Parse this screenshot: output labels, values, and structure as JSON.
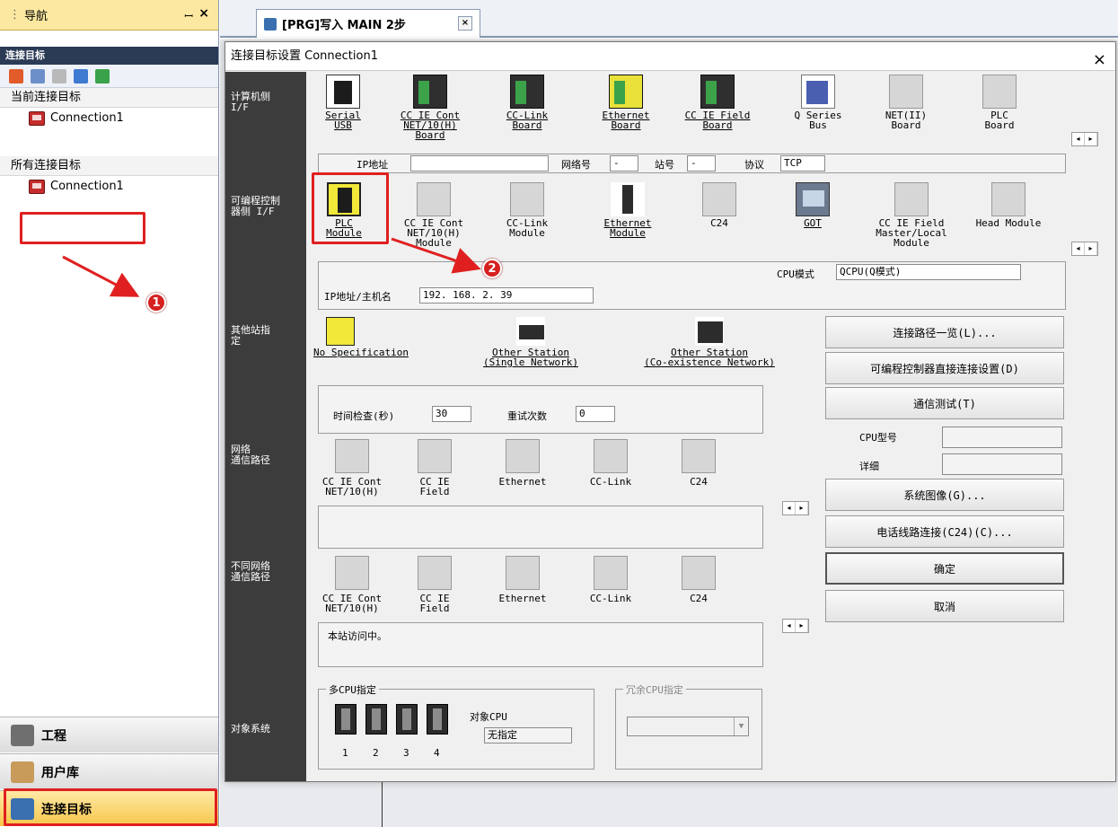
{
  "nav": {
    "title": "导航",
    "pin_glyph": "ꟷ",
    "close_glyph": "×",
    "subhead": "连接目标",
    "current_section": "当前连接目标",
    "current_item": "Connection1",
    "all_section": "所有连接目标",
    "all_item": "Connection1",
    "bottom": {
      "project": "工程",
      "library": "用户库",
      "connection": "连接目标"
    }
  },
  "annotations": {
    "badge1": "1",
    "badge2": "2"
  },
  "tab": {
    "label": "[PRG]写入 MAIN 2步",
    "close_glyph": "×"
  },
  "dialog": {
    "title": "连接目标设置 Connection1",
    "close_glyph": "×",
    "side": {
      "pc_if": "计算机侧\nI/F",
      "plc_if": "可编程控制\n器侧 I/F",
      "other_station": "其他站指\n定",
      "network_route": "网络\n通信路径",
      "diff_network_route": "不同网络\n通信路径",
      "target_system": "对象系统"
    },
    "pc_items": [
      {
        "label": "Serial\nUSB"
      },
      {
        "label": "CC IE Cont\nNET/10(H)\nBoard"
      },
      {
        "label": "CC-Link\nBoard"
      },
      {
        "label": "Ethernet\nBoard"
      },
      {
        "label": "CC IE Field\nBoard"
      },
      {
        "label": "Q Series\nBus"
      },
      {
        "label": "NET(II)\nBoard"
      },
      {
        "label": "PLC\nBoard"
      }
    ],
    "pc_info": {
      "ip_label": "IP地址",
      "ip_value": "",
      "net_label": "网络号",
      "net_value": "-",
      "station_label": "站号",
      "station_value": "-",
      "protocol_label": "协议",
      "protocol_value": "TCP"
    },
    "plc_items": [
      {
        "label": "PLC\nModule"
      },
      {
        "label": "CC IE Cont\nNET/10(H)\nModule"
      },
      {
        "label": "CC-Link\nModule"
      },
      {
        "label": "Ethernet\nModule"
      },
      {
        "label": "C24"
      },
      {
        "label": "GOT"
      },
      {
        "label": "CC IE Field\nMaster/Local\nModule"
      },
      {
        "label": "Head Module"
      }
    ],
    "plc_info": {
      "cpu_mode_label": "CPU模式",
      "cpu_mode_value": "QCPU(Q模式)",
      "ip_host_label": "IP地址/主机名",
      "ip_host_value": "192. 168. 2. 39"
    },
    "other_station": [
      {
        "label": "No Specification"
      },
      {
        "label": "Other Station\n(Single Network)"
      },
      {
        "label": "Other Station\n(Co-existence Network)"
      }
    ],
    "timing": {
      "time_check_label": "时间检查(秒)",
      "time_check_value": "30",
      "retry_label": "重试次数",
      "retry_value": "0"
    },
    "routes": [
      "CC IE Cont\nNET/10(H)",
      "CC IE\nField",
      "Ethernet",
      "CC-Link",
      "C24"
    ],
    "diff_routes": [
      "CC IE Cont\nNET/10(H)",
      "CC IE\nField",
      "Ethernet",
      "CC-Link",
      "C24"
    ],
    "status_text": "本站访问中。",
    "multi_cpu": {
      "title": "多CPU指定",
      "numbers": [
        "1",
        "2",
        "3",
        "4"
      ],
      "target_label": "对象CPU",
      "target_value": "无指定"
    },
    "redundant": {
      "title": "冗余CPU指定",
      "value": ""
    },
    "buttons": {
      "route_list": "连接路径一览(L)...",
      "direct_connect": "可编程控制器直接连接设置(D)",
      "comm_test": "通信测试(T)",
      "system_image": "系统图像(G)...",
      "phone_connect": "电话线路连接(C24)(C)...",
      "ok": "确定",
      "cancel": "取消"
    },
    "cpu_info": {
      "cpu_type_label": "CPU型号",
      "cpu_type_value": "",
      "detail_label": "详细",
      "detail_value": ""
    }
  },
  "colors": {
    "highlight_red": "#e02020",
    "nav_title_bg": "#fce8a0",
    "active_tab_bg": "#f7c64a",
    "dialog_side_bg": "#3c3c3c"
  }
}
